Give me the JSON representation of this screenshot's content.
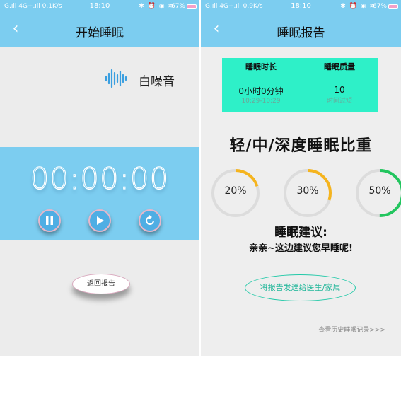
{
  "left_phone": {
    "status": {
      "signal": "G.ıll 4G+.ıll 0.1K/s",
      "time": "18:10",
      "icons": "✱ ⏰ ◉ ≋",
      "battery": "67%"
    },
    "nav": {
      "back": "‹",
      "title": "开始睡眠"
    },
    "white_noise": {
      "icon": "sound-wave-icon",
      "label": "白噪音"
    },
    "timer": {
      "value": "00:00:00"
    },
    "controls": [
      "pause-icon",
      "play-icon",
      "replay-icon"
    ],
    "report_button": "返回报告"
  },
  "right_phone": {
    "status": {
      "signal": "G.ıll 4G+.ıll 0.9K/s",
      "time": "18:10",
      "icons": "✱ ⏰ ◉ ≋",
      "battery": "67%"
    },
    "nav": {
      "back": "‹",
      "title": "睡眠报告"
    },
    "summary": {
      "duration": {
        "header": "睡眠时长",
        "value": "0小时0分钟",
        "sub": "10:29-10:29"
      },
      "quality": {
        "header": "睡眠质量",
        "value": "10",
        "sub": "时间过短"
      }
    },
    "ratio_title": "轻/中/深度睡眠比重",
    "rings": [
      {
        "label": "20%",
        "value": 0.2,
        "color": "#f5b41e"
      },
      {
        "label": "30%",
        "value": 0.3,
        "color": "#f5b41e"
      },
      {
        "label": "50%",
        "value": 0.5,
        "color": "#22c55e"
      }
    ],
    "advice_title": "睡眠建议:",
    "advice_text": "亲亲~这边建议您早睡呢!",
    "send_button": "将报告发送给医生/家属",
    "history_link": "查看历史睡眠记录>>>"
  },
  "colors": {
    "primary": "#7ccdf0",
    "summary_bg": "#2ef0c8",
    "accent_green": "#22c9a8",
    "ring_track": "#dcdcdc"
  }
}
